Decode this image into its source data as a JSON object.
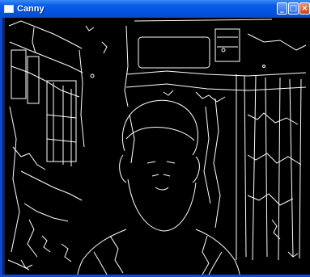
{
  "window": {
    "title": "Canny",
    "icon": "window-app-icon",
    "controls": {
      "minimize_icon": "minimize-icon",
      "maximize_icon": "maximize-icon",
      "close_icon": "close-icon"
    }
  },
  "image": {
    "description_type": "canny-edge-map",
    "foreground": "#ffffff",
    "background": "#000000"
  }
}
